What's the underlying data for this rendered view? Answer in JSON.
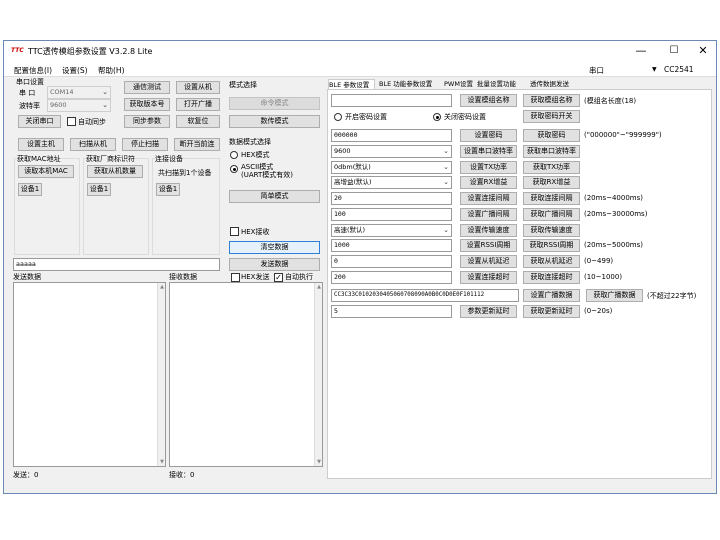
{
  "window": {
    "logo": "TTC",
    "title": "TTC透传模组参数设置 V3.2.8 Lite",
    "min": "—",
    "max": "☐",
    "close": "✕"
  },
  "menu": [
    "配置信息(I)",
    "设置(S)",
    "帮助(H)"
  ],
  "top_right": {
    "port_label": "串口",
    "module": "CC2541"
  },
  "serial": {
    "title": "串口设置",
    "port_label": "串 口",
    "port_value": "COM14",
    "baud_label": "波特率",
    "baud_value": "9600",
    "close_btn": "关闭串口",
    "auto_sync": "自动同步"
  },
  "btns1": [
    "通信测试",
    "获取版本号",
    "同步参数"
  ],
  "btns2": [
    "设置从机",
    "打开广播",
    "软复位"
  ],
  "mode": {
    "title": "模式选择",
    "cmd": "命令模式",
    "transmit": "数传模式"
  },
  "data_mode": {
    "title": "数据模式选择",
    "hex": "HEX模式",
    "ascii1": "ASCII模式",
    "ascii2": "(UART模式有效)",
    "simple": "简单模式"
  },
  "conn": {
    "set_master": "设置主机",
    "scan_slave": "扫描从机",
    "stop_scan": "停止扫描",
    "disconnect": "断开当前连"
  },
  "mac": {
    "title": "获取MAC地址",
    "btn": "读取本机MAC",
    "dev": "设备1"
  },
  "vendor": {
    "title": "获取厂商标识符",
    "btn": "获取从机数量",
    "dev": "设备1"
  },
  "connected": {
    "title": "连接设备",
    "btn": "共扫描到1个设备",
    "dev": "设备1"
  },
  "hex_recv": "HEX接收",
  "clear_btn": "清空数据",
  "send_input": "aaaaa",
  "send_btn": "发送数据",
  "send_area": {
    "label": "发送数据",
    "count": "发送：0"
  },
  "recv_area": {
    "label": "接收数据",
    "count": "接收：0"
  },
  "hex_send": "HEX发送",
  "auto_exec": "自动执行",
  "tabs": [
    "BLE 参数设置",
    "BLE 功能参数设置",
    "PWM设置",
    "批量设置功能",
    "透传数据发送"
  ],
  "params": {
    "name": {
      "set": "设置模组名称",
      "get": "获取模组名称",
      "note": "(模组名长度(18)"
    },
    "pwd_off": "开启密码设置",
    "pwd_on": "关闭密码设置",
    "pwd_get": "获取密码开关",
    "pwd": {
      "value": "000000",
      "set": "设置密码",
      "get": "获取密码",
      "note": "(\"000000\"~\"999999\")"
    },
    "baud": {
      "value": "9600",
      "set": "设置串口波特率",
      "get": "获取串口波特率"
    },
    "tx": {
      "value": "0dbm(默认)",
      "set": "设置TX功率",
      "get": "获取TX功率"
    },
    "rx": {
      "value": "高增益(默认)",
      "set": "设置RX增益",
      "get": "获取RX增益"
    },
    "conn_int": {
      "value": "20",
      "set": "设置连接间隔",
      "get": "获取连接间隔",
      "note": "(20ms~4000ms)"
    },
    "adv_int": {
      "value": "100",
      "set": "设置广播间隔",
      "get": "获取广播间隔",
      "note": "(20ms~30000ms)"
    },
    "speed": {
      "value": "高速(默认)",
      "set": "设置传输速度",
      "get": "获取传输速度"
    },
    "rssi": {
      "value": "1000",
      "set": "设置RSSI周期",
      "get": "获取RSSI周期",
      "note": "(20ms~5000ms)"
    },
    "delay": {
      "value": "0",
      "set": "设置从机延迟",
      "get": "获取从机延迟",
      "note": "(0~499)"
    },
    "timeout": {
      "value": "200",
      "set": "设置连接超时",
      "get": "获取连接超时",
      "note": "(10~1000)"
    },
    "adv_data": {
      "value": "CC3C33C0102030405060708090A0B0C0D0E0F101112",
      "set": "设置广播数据",
      "get": "获取广播数据",
      "note": "(不超过22字节)"
    },
    "update": {
      "value": "5",
      "set": "参数更新延时",
      "get": "获取更新延时",
      "note": "(0~20s)"
    }
  }
}
